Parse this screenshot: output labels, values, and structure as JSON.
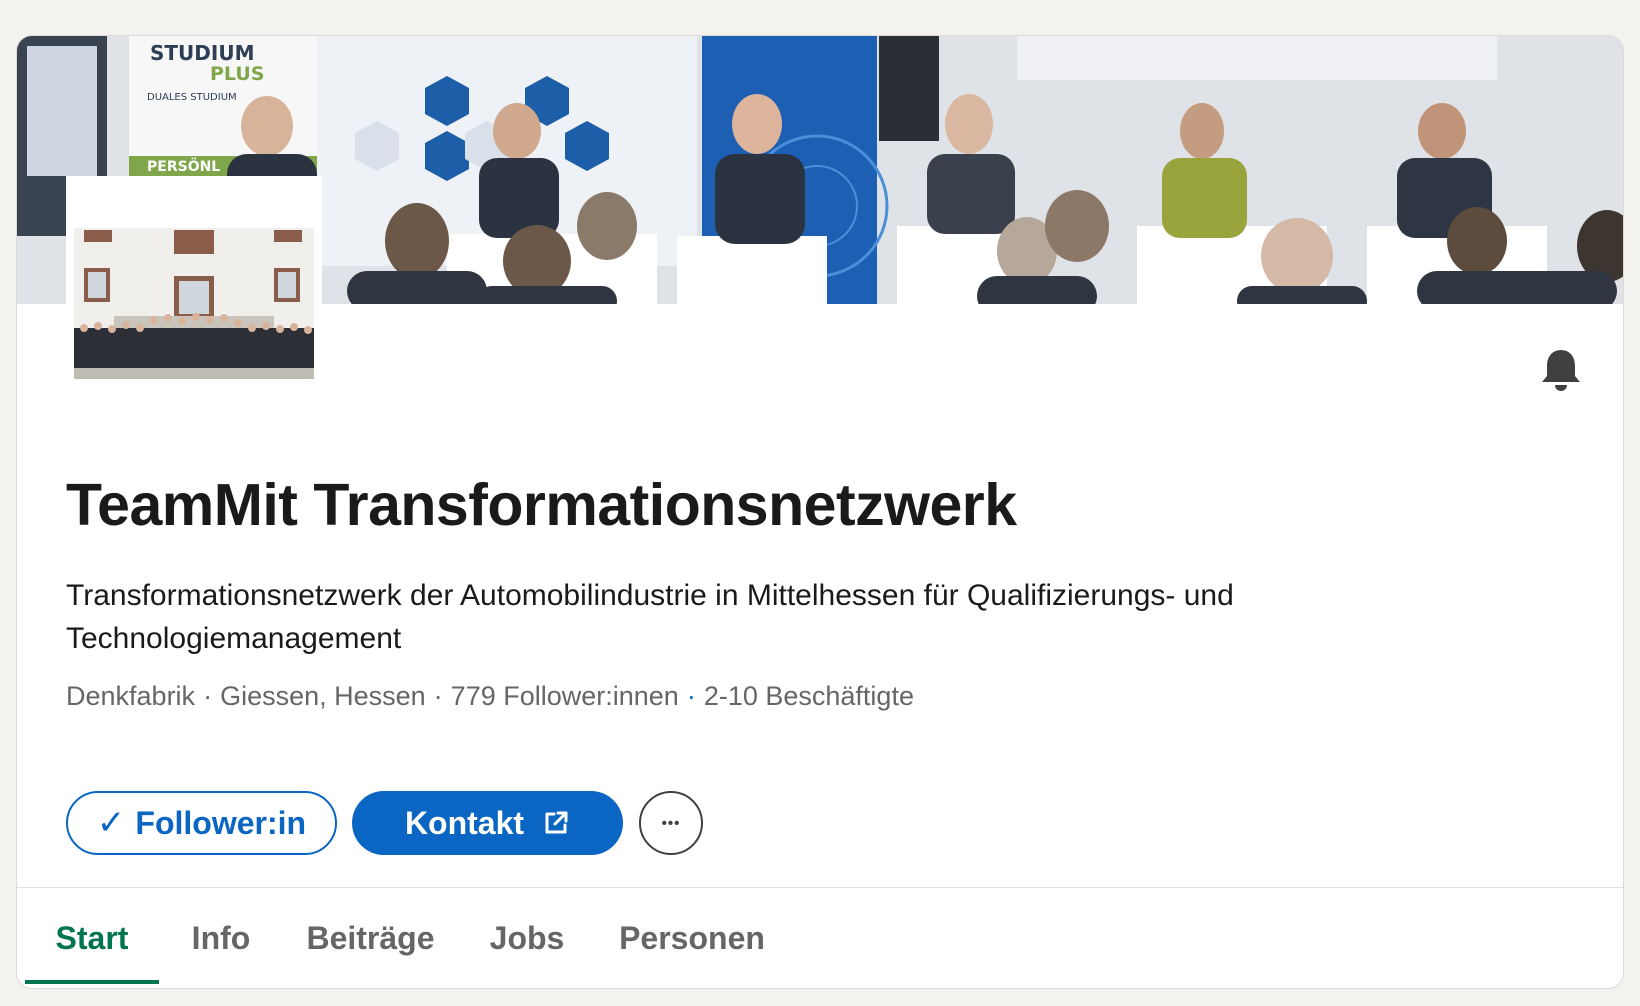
{
  "company": {
    "name": "TeamMit Transformationsnetzwerk",
    "tagline": "Transformationsnetzwerk der Automobilindustrie in Mittelhessen für Qualifizierungs- und Technologiemanagement",
    "industry": "Denkfabrik",
    "location": "Giessen, Hessen",
    "followers": "779 Follower:innen",
    "employees": "2-10 Beschäftigte"
  },
  "actions": {
    "follow_label": "Follower:in",
    "follow_check": "✓",
    "contact_label": "Kontakt",
    "more_label": "•••"
  },
  "tabs": [
    {
      "label": "Start",
      "active": true
    },
    {
      "label": "Info",
      "active": false
    },
    {
      "label": "Beiträge",
      "active": false
    },
    {
      "label": "Jobs",
      "active": false
    },
    {
      "label": "Personen",
      "active": false
    }
  ],
  "cover_banner": {
    "logo_line1": "STUDIUM",
    "logo_line2": "PLUS",
    "logo_line3": "DUALES STUDIUM",
    "banner_text": "PERSÖNL"
  },
  "icons": {
    "notification": "bell-icon",
    "external_link": "external-link-icon",
    "check": "check-icon",
    "more": "more-icon"
  },
  "colors": {
    "primary": "#0a66c2",
    "active_tab": "#01754f",
    "text": "#1a1a1a",
    "muted": "#666666"
  }
}
